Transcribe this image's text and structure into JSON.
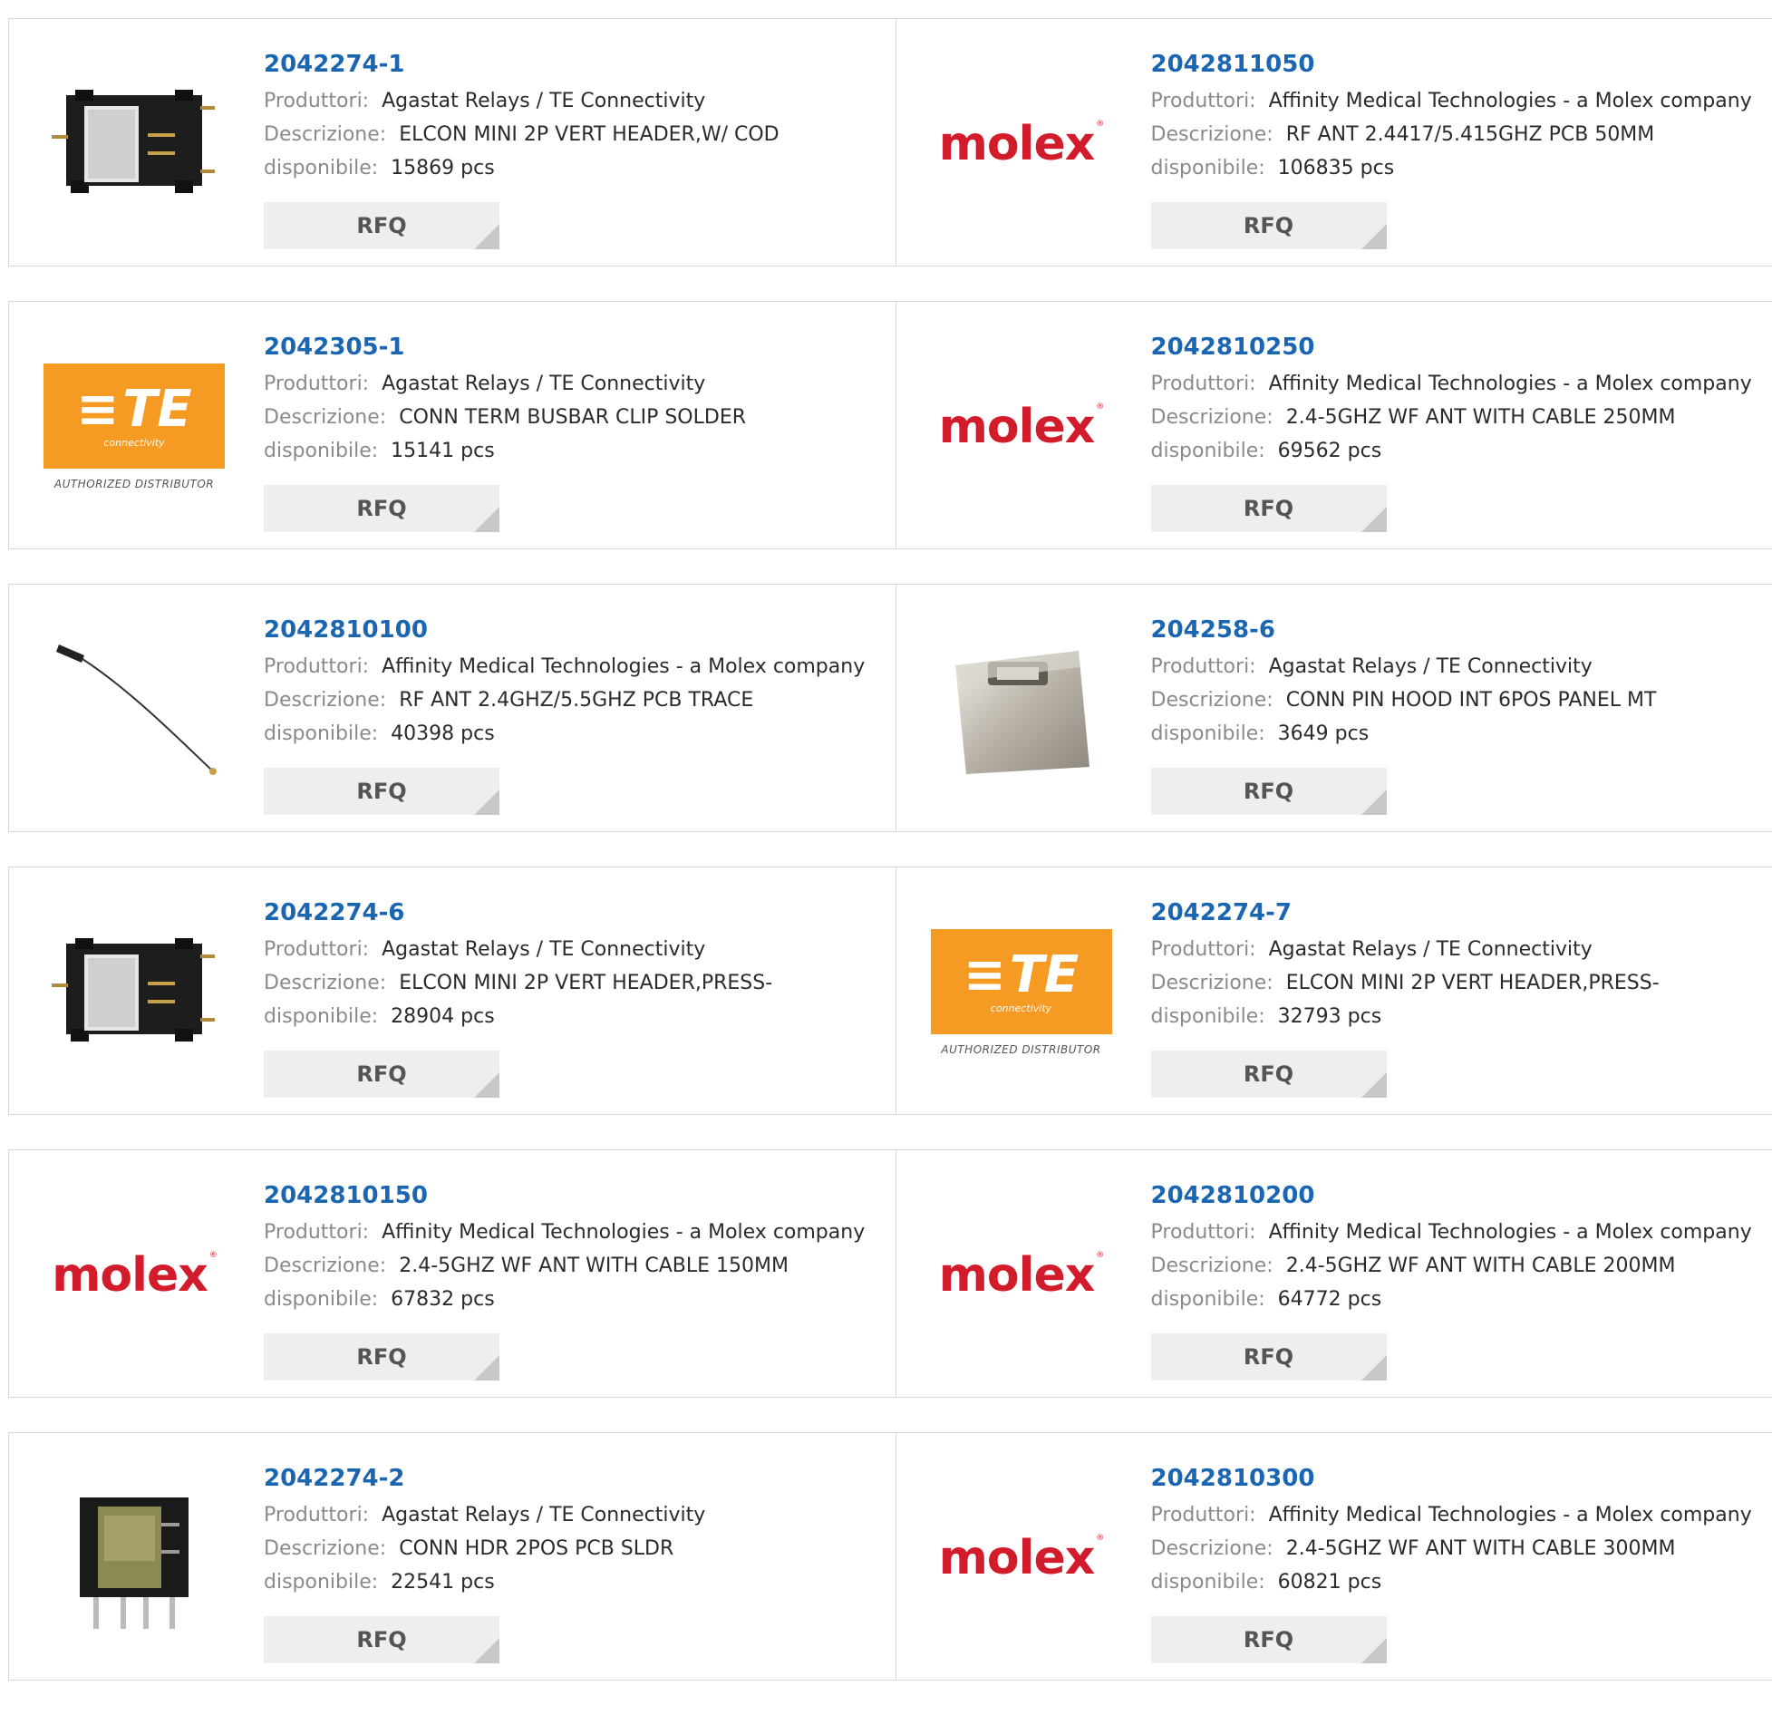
{
  "labels": {
    "manufacturer": "Produttori:",
    "description": "Descrizione:",
    "available": "disponibile:",
    "rfq": "RFQ"
  },
  "brands": {
    "molex": "molex",
    "molex_mark": "®",
    "te": "TE",
    "te_sub": "connectivity",
    "te_dist": "AUTHORIZED DISTRIBUTOR"
  },
  "colors": {
    "part_link": "#1a66b2",
    "molex_red": "#d21b2b",
    "te_orange": "#f59a23",
    "rfq_bg": "#eeeeee"
  },
  "products": [
    {
      "part": "2042274-1",
      "manufacturer": "Agastat Relays / TE Connectivity",
      "description": "ELCON MINI 2P VERT HEADER,W/ COD",
      "available": "15869 pcs",
      "image": "header-connector-icon"
    },
    {
      "part": "2042811050",
      "manufacturer": "Affinity Medical Technologies - a Molex company",
      "description": "RF ANT 2.4417/5.415GHZ PCB 50MM",
      "available": "106835 pcs",
      "image": "molex-logo"
    },
    {
      "part": "2042305-1",
      "manufacturer": "Agastat Relays / TE Connectivity",
      "description": "CONN TERM BUSBAR CLIP SOLDER",
      "available": "15141 pcs",
      "image": "te-logo"
    },
    {
      "part": "2042810250",
      "manufacturer": "Affinity Medical Technologies - a Molex company",
      "description": "2.4-5GHZ WF ANT WITH CABLE 250MM",
      "available": "69562 pcs",
      "image": "molex-logo"
    },
    {
      "part": "2042810100",
      "manufacturer": "Affinity Medical Technologies - a Molex company",
      "description": "RF ANT 2.4GHZ/5.5GHZ PCB TRACE",
      "available": "40398 pcs",
      "image": "antenna-cable-icon"
    },
    {
      "part": "204258-6",
      "manufacturer": "Agastat Relays / TE Connectivity",
      "description": "CONN PIN HOOD INT 6POS PANEL MT",
      "available": "3649 pcs",
      "image": "metal-hood-icon"
    },
    {
      "part": "2042274-6",
      "manufacturer": "Agastat Relays / TE Connectivity",
      "description": "ELCON MINI 2P VERT HEADER,PRESS-",
      "available": "28904 pcs",
      "image": "header-connector-icon"
    },
    {
      "part": "2042274-7",
      "manufacturer": "Agastat Relays / TE Connectivity",
      "description": "ELCON MINI 2P VERT HEADER,PRESS-",
      "available": "32793 pcs",
      "image": "te-logo"
    },
    {
      "part": "2042810150",
      "manufacturer": "Affinity Medical Technologies - a Molex company",
      "description": "2.4-5GHZ WF ANT WITH CABLE 150MM",
      "available": "67832 pcs",
      "image": "molex-logo"
    },
    {
      "part": "2042810200",
      "manufacturer": "Affinity Medical Technologies - a Molex company",
      "description": "2.4-5GHZ WF ANT WITH CABLE 200MM",
      "available": "64772 pcs",
      "image": "molex-logo"
    },
    {
      "part": "2042274-2",
      "manufacturer": "Agastat Relays / TE Connectivity",
      "description": "CONN HDR 2POS PCB SLDR",
      "available": "22541 pcs",
      "image": "pcb-header-icon"
    },
    {
      "part": "2042810300",
      "manufacturer": "Affinity Medical Technologies - a Molex company",
      "description": "2.4-5GHZ WF ANT WITH CABLE 300MM",
      "available": "60821 pcs",
      "image": "molex-logo"
    }
  ]
}
